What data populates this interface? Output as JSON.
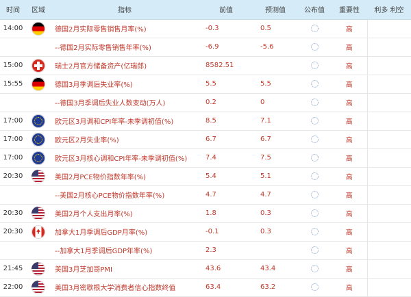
{
  "header": {
    "time": "时间",
    "area": "区域",
    "indicator": "指标",
    "previous": "前值",
    "forecast": "预测值",
    "published": "公布值",
    "importance": "重要性",
    "impact": "利多 利空"
  },
  "rows": [
    {
      "time": "14:00",
      "flag": "de",
      "flag_icon": "germany-flag-icon",
      "indicator": "德国2月实际零售销售月率(%)",
      "previous": "-0.3",
      "forecast": "0.5",
      "importance": "高"
    },
    {
      "time": "",
      "flag": "",
      "flag_icon": "",
      "indicator": "--德国2月实际零售销售年率(%)",
      "previous": "-6.9",
      "forecast": "-5.6",
      "importance": "高"
    },
    {
      "time": "15:00",
      "flag": "ch",
      "flag_icon": "switzerland-flag-icon",
      "indicator": "瑞士2月官方储备资产(亿瑞郎)",
      "previous": "8582.51",
      "forecast": "",
      "importance": "高"
    },
    {
      "time": "15:55",
      "flag": "de",
      "flag_icon": "germany-flag-icon",
      "indicator": "德国3月季调后失业率(%)",
      "previous": "5.5",
      "forecast": "5.5",
      "importance": "高"
    },
    {
      "time": "",
      "flag": "",
      "flag_icon": "",
      "indicator": "--德国3月季调后失业人数变动(万人)",
      "previous": "0.2",
      "forecast": "0",
      "importance": "高"
    },
    {
      "time": "17:00",
      "flag": "eu",
      "flag_icon": "eurozone-flag-icon",
      "indicator": "欧元区3月调和CPI年率-未季调初值(%)",
      "previous": "8.5",
      "forecast": "7.1",
      "importance": "高"
    },
    {
      "time": "17:00",
      "flag": "eu",
      "flag_icon": "eurozone-flag-icon",
      "indicator": "欧元区2月失业率(%)",
      "previous": "6.7",
      "forecast": "6.7",
      "importance": "高"
    },
    {
      "time": "17:00",
      "flag": "eu",
      "flag_icon": "eurozone-flag-icon",
      "indicator": "欧元区3月核心调和CPI年率-未季调初值(%)",
      "previous": "7.4",
      "forecast": "7.5",
      "importance": "高"
    },
    {
      "time": "20:30",
      "flag": "us",
      "flag_icon": "usa-flag-icon",
      "indicator": "美国2月PCE物价指数年率(%)",
      "previous": "5.4",
      "forecast": "5.1",
      "importance": "高"
    },
    {
      "time": "",
      "flag": "",
      "flag_icon": "",
      "indicator": "--美国2月核心PCE物价指数年率(%)",
      "previous": "4.7",
      "forecast": "4.7",
      "importance": "高"
    },
    {
      "time": "20:30",
      "flag": "us",
      "flag_icon": "usa-flag-icon",
      "indicator": "美国2月个人支出月率(%)",
      "previous": "1.8",
      "forecast": "0.3",
      "importance": "高"
    },
    {
      "time": "20:30",
      "flag": "ca",
      "flag_icon": "canada-flag-icon",
      "indicator": "加拿大1月季调后GDP月率(%)",
      "previous": "-0.1",
      "forecast": "0.3",
      "importance": "高"
    },
    {
      "time": "",
      "flag": "",
      "flag_icon": "",
      "indicator": "--加拿大1月季调后GDP年率(%)",
      "previous": "2.3",
      "forecast": "",
      "importance": "高"
    },
    {
      "time": "21:45",
      "flag": "us",
      "flag_icon": "usa-flag-icon",
      "indicator": "美国3月芝加哥PMI",
      "previous": "43.6",
      "forecast": "43.4",
      "importance": "高"
    },
    {
      "time": "22:00",
      "flag": "us",
      "flag_icon": "usa-flag-icon",
      "indicator": "美国3月密歇根大学消费者信心指数终值",
      "previous": "63.4",
      "forecast": "63.2",
      "importance": "高"
    }
  ],
  "icons": {
    "pending": "loading-spinner-icon"
  }
}
